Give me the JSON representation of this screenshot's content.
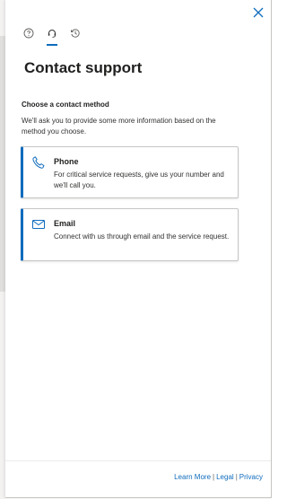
{
  "panel": {
    "title": "Contact support",
    "section_title": "Choose a contact method",
    "section_description": "We'll ask you to provide some more information based on the method you choose."
  },
  "tabs": [
    {
      "icon": "help-circle-icon",
      "active": false
    },
    {
      "icon": "headset-icon",
      "active": true
    },
    {
      "icon": "history-icon",
      "active": false
    }
  ],
  "contact_methods": [
    {
      "icon": "phone-icon",
      "title": "Phone",
      "description": "For critical service requests, give us your number and we'll call you."
    },
    {
      "icon": "mail-icon",
      "title": "Email",
      "description": "Connect with us through email and the service request."
    }
  ],
  "footer": {
    "learn_more": "Learn More",
    "legal": "Legal",
    "privacy": "Privacy",
    "separator": "|"
  },
  "colors": {
    "accent": "#0f6cbd",
    "text": "#201f1e",
    "border": "#c8c6c4"
  }
}
